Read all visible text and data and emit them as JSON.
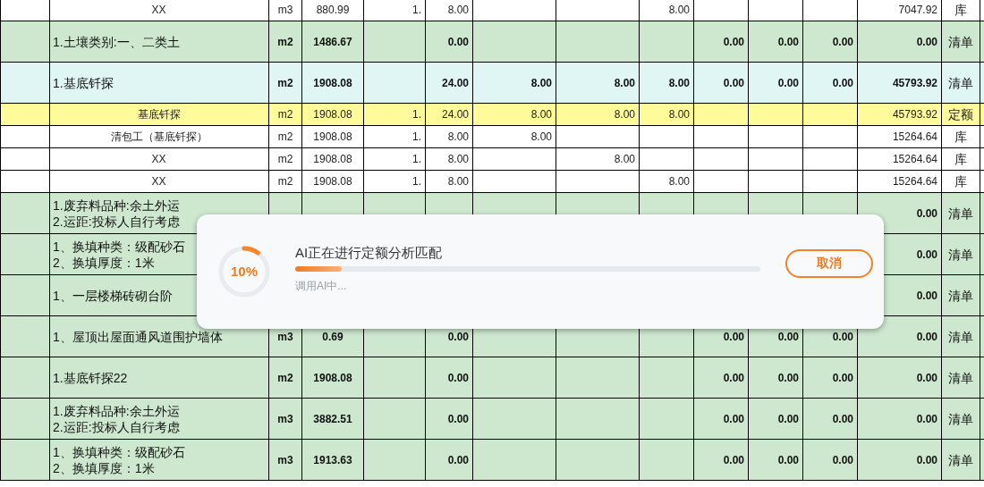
{
  "table": {
    "rows": [
      {
        "kind": "resource",
        "selected": false,
        "cells": [
          "",
          "XX",
          "m3",
          "880.99",
          "1.",
          "8.00",
          "",
          "",
          "8.00",
          "",
          "",
          "",
          "7047.92",
          "库"
        ]
      },
      {
        "kind": "bill",
        "selected": false,
        "cells": [
          "",
          "1.土壤类别:一、二类土",
          "m2",
          "1486.67",
          "",
          "0.00",
          "",
          "",
          "",
          "0.00",
          "0.00",
          "0.00",
          "0.00",
          "清单"
        ]
      },
      {
        "kind": "bill",
        "selected": true,
        "cells": [
          "",
          "1.基底钎探",
          "m2",
          "1908.08",
          "",
          "24.00",
          "8.00",
          "8.00",
          "8.00",
          "0.00",
          "0.00",
          "0.00",
          "45793.92",
          "清单"
        ]
      },
      {
        "kind": "quota",
        "selected": false,
        "cells": [
          "",
          "基底钎探",
          "m2",
          "1908.08",
          "1.",
          "24.00",
          "8.00",
          "8.00",
          "8.00",
          "",
          "",
          "",
          "45793.92",
          "定额"
        ]
      },
      {
        "kind": "resource",
        "selected": false,
        "cells": [
          "",
          "清包工（基底钎探）",
          "m2",
          "1908.08",
          "1.",
          "8.00",
          "8.00",
          "",
          "",
          "",
          "",
          "",
          "15264.64",
          "库"
        ]
      },
      {
        "kind": "resource",
        "selected": false,
        "cells": [
          "",
          "XX",
          "m2",
          "1908.08",
          "1.",
          "8.00",
          "",
          "8.00",
          "",
          "",
          "",
          "",
          "15264.64",
          "库"
        ]
      },
      {
        "kind": "resource",
        "selected": false,
        "cells": [
          "",
          "XX",
          "m2",
          "1908.08",
          "1.",
          "8.00",
          "",
          "",
          "8.00",
          "",
          "",
          "",
          "15264.64",
          "库"
        ]
      },
      {
        "kind": "bill",
        "selected": false,
        "cells": [
          "",
          "1.废弃料品种:余土外运\n2.运距:投标人自行考虑",
          "",
          "",
          "",
          "",
          "",
          "",
          "",
          "",
          "",
          "",
          "0.00",
          "清单"
        ]
      },
      {
        "kind": "bill",
        "selected": false,
        "cells": [
          "",
          "1、换填种类：级配砂石\n2、换填厚度：1米",
          "",
          "",
          "",
          "",
          "",
          "",
          "",
          "",
          "",
          "",
          "0.00",
          "清单"
        ]
      },
      {
        "kind": "bill",
        "selected": false,
        "cells": [
          "",
          "1、一层楼梯砖砌台阶",
          "",
          "",
          "",
          "",
          "",
          "",
          "",
          "",
          "",
          "",
          "0.00",
          "清单"
        ]
      },
      {
        "kind": "bill",
        "selected": false,
        "cells": [
          "",
          "1、屋顶出屋面通风道围护墙体",
          "m3",
          "0.69",
          "",
          "0.00",
          "",
          "",
          "",
          "0.00",
          "0.00",
          "0.00",
          "0.00",
          "清单"
        ]
      },
      {
        "kind": "bill",
        "selected": false,
        "cells": [
          "",
          "1.基底钎探22",
          "m2",
          "1908.08",
          "",
          "0.00",
          "",
          "",
          "",
          "0.00",
          "0.00",
          "0.00",
          "0.00",
          "清单"
        ]
      },
      {
        "kind": "bill",
        "selected": false,
        "cells": [
          "",
          "1.废弃料品种:余土外运\n2.运距:投标人自行考虑",
          "m3",
          "3882.51",
          "",
          "0.00",
          "",
          "",
          "",
          "0.00",
          "0.00",
          "0.00",
          "0.00",
          "清单"
        ]
      },
      {
        "kind": "bill",
        "selected": false,
        "cells": [
          "",
          "1、换填种类：级配砂石\n2、换填厚度：1米",
          "m3",
          "1913.63",
          "",
          "0.00",
          "",
          "",
          "",
          "0.00",
          "0.00",
          "0.00",
          "0.00",
          "清单"
        ]
      }
    ]
  },
  "dialog": {
    "percent": "10%",
    "level": 0.1,
    "title": "AI正在进行定额分析匹配",
    "status": "调用AI中...",
    "cancel": "取消"
  }
}
